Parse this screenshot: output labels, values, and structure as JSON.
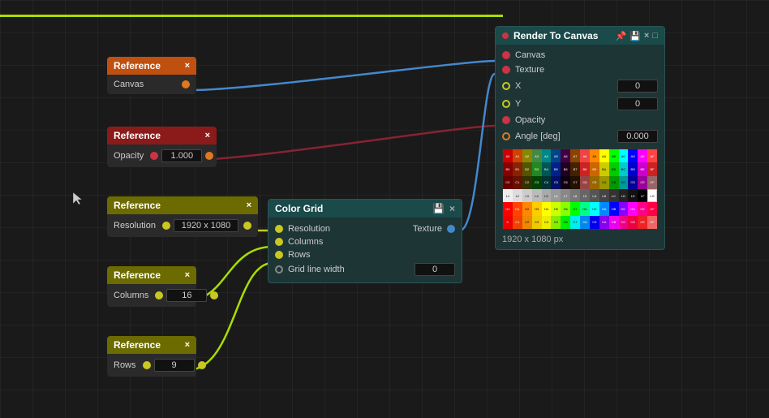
{
  "nodes": {
    "ref1": {
      "title": "Reference",
      "close": "×",
      "port_label": "Canvas",
      "style": "orange"
    },
    "ref2": {
      "title": "Reference",
      "close": "×",
      "port_label": "Opacity",
      "value": "1.000",
      "style": "red"
    },
    "ref3": {
      "title": "Reference",
      "close": "×",
      "port_label": "Resolution",
      "value": "1920 x 1080",
      "style": "olive"
    },
    "ref4": {
      "title": "Reference",
      "close": "×",
      "port_label": "Columns",
      "value": "16",
      "style": "olive"
    },
    "ref5": {
      "title": "Reference",
      "close": "×",
      "port_label": "Rows",
      "value": "9",
      "style": "olive"
    },
    "colorgrid": {
      "title": "Color Grid",
      "labels": [
        "Resolution",
        "Columns",
        "Rows",
        "Grid line width"
      ],
      "grid_width_value": "0",
      "texture_label": "Texture"
    },
    "render": {
      "title": "Render To Canvas",
      "icon_pin": "📌",
      "icon_save": "💾",
      "icon_close": "×",
      "icon_expand": "□",
      "rows": [
        {
          "label": "Canvas",
          "has_port": true,
          "port_color": "red",
          "value": null
        },
        {
          "label": "Texture",
          "has_port": true,
          "port_color": "red",
          "value": null
        },
        {
          "label": "X",
          "has_port": true,
          "port_color": "yellow",
          "value": "0"
        },
        {
          "label": "Y",
          "has_port": true,
          "port_color": "yellow",
          "value": "0"
        },
        {
          "label": "Opacity",
          "has_port": true,
          "port_color": "red",
          "value": null
        },
        {
          "label": "Angle [deg]",
          "has_port": true,
          "port_color": "orange",
          "value": "0.000"
        }
      ],
      "resolution_display": "1920 x 1080 px"
    }
  },
  "colors": {
    "orange_header": "#c05010",
    "red_header": "#8b1a1a",
    "olive_header": "#6b6b00",
    "teal_header": "#1a4a4a",
    "bg": "#1a1a1a",
    "node_body": "#2a2a2a"
  }
}
